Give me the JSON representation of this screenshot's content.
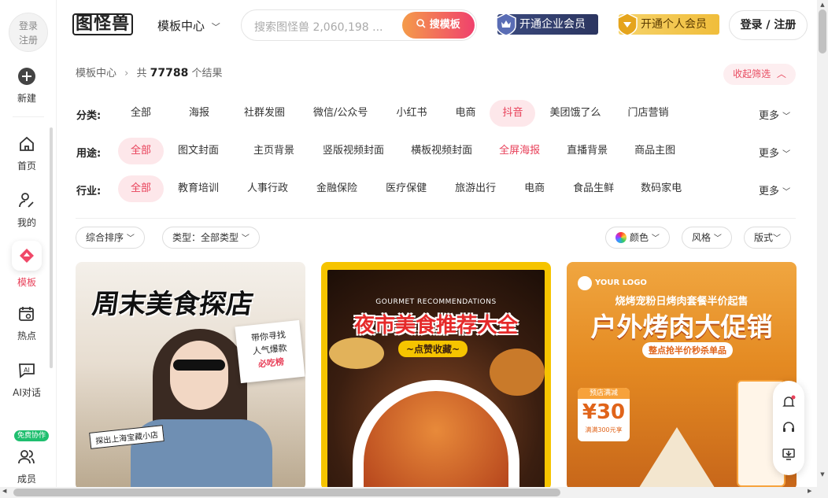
{
  "sidebar": {
    "login": [
      "登录",
      "注册"
    ],
    "items": [
      {
        "label": "新建",
        "icon": "plus-circle-icon"
      },
      {
        "label": "首页",
        "icon": "home-icon"
      },
      {
        "label": "我的",
        "icon": "user-edit-icon"
      },
      {
        "label": "模板",
        "icon": "template-icon"
      },
      {
        "label": "热点",
        "icon": "calendar-search-icon"
      },
      {
        "label": "AI对话",
        "icon": "ai-chat-icon"
      },
      {
        "label": "成员",
        "icon": "members-icon"
      }
    ],
    "free_badge": "免费协作"
  },
  "header": {
    "logo": "图怪兽",
    "nav": "模板中心",
    "search_placeholder": "搜索图怪兽 2,060,198 ...",
    "search_button": "搜模板",
    "vip_enterprise": "开通企业会员",
    "vip_personal": "开通个人会员",
    "login": "登录 / 注册"
  },
  "breadcrumb": {
    "root": "模板中心",
    "prefix": "共",
    "count": "77788",
    "suffix": "个结果"
  },
  "collapse_filter": "收起筛选",
  "filters": [
    {
      "label": "分类:",
      "active_index": 8,
      "options": [
        "全部",
        "海报",
        "社群发圈",
        "微信/公众号",
        "小红书",
        "电商",
        "抖音",
        "美团饿了么",
        "门店营销"
      ],
      "more": "更多"
    },
    {
      "label": "用途:",
      "active_index": 0,
      "options": [
        "全部",
        "图文封面",
        "主页背景",
        "竖版视频封面",
        "横板视频封面",
        "全屏海报",
        "直播背景",
        "商品主图"
      ],
      "more": "更多"
    },
    {
      "label": "行业:",
      "active_index": 0,
      "options": [
        "全部",
        "教育培训",
        "人事行政",
        "金融保险",
        "医疗保健",
        "旅游出行",
        "电商",
        "食品生鲜",
        "数码家电"
      ],
      "more": "更多"
    }
  ],
  "sort": {
    "sort": "综合排序",
    "type": "类型：全部类型",
    "color": "颜色",
    "style": "风格",
    "format": "版式"
  },
  "cards": [
    {
      "title": "周末美食探店",
      "note": [
        "带你寻找",
        "人气爆款",
        "必吃榜"
      ],
      "tag": "探出上海宝藏小店"
    },
    {
      "title": "夜市美食推荐大全",
      "sub_en": "GOURMET RECOMMENDATIONS",
      "sub": "~点赞收藏~"
    },
    {
      "logo": "YOUR LOGO",
      "top": "烧烤宠粉日烤肉套餐半价起售",
      "title": "户外烤肉大促销",
      "sub": "整点抢半价秒杀单品",
      "coupon_label": "预店满减",
      "coupon_value": "¥30",
      "coupon_cond": "满满300元享"
    }
  ],
  "colors": {
    "accent": "#e8415a",
    "chip_active_bg": "#fde7ea"
  }
}
